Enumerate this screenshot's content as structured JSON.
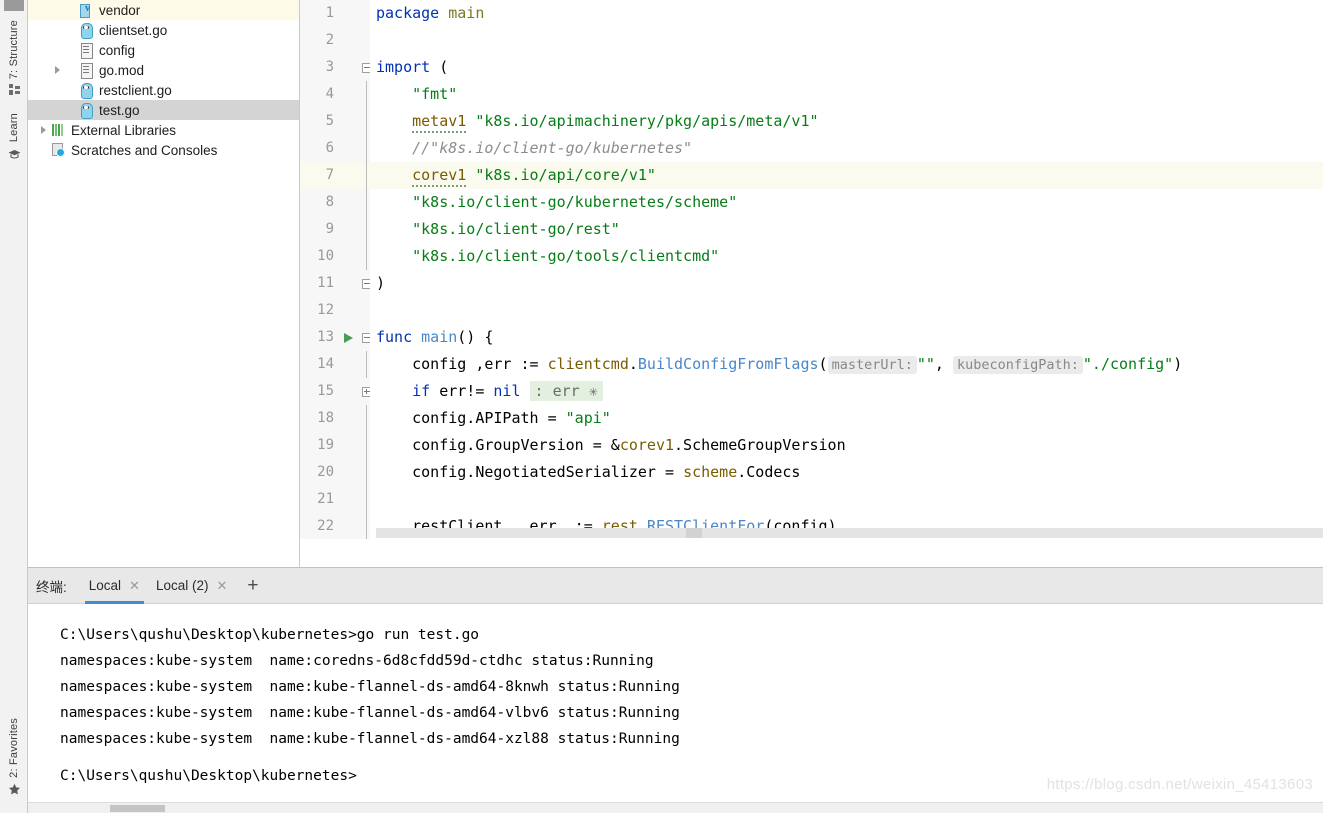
{
  "tool_strip": {
    "top_items": [
      {
        "label": "7: Structure",
        "icon": "structure-icon"
      },
      {
        "label": "Learn",
        "icon": "graduation-cap-icon"
      }
    ],
    "bottom_items": [
      {
        "label": "2: Favorites",
        "icon": "star-icon"
      }
    ]
  },
  "project_tree": {
    "items": [
      {
        "label": "vendor",
        "icon": "vendor-folder-icon",
        "indent": 2,
        "arrow": false,
        "state": "highlighted"
      },
      {
        "label": "clientset.go",
        "icon": "go-file-icon",
        "indent": 2,
        "arrow": false,
        "state": "normal"
      },
      {
        "label": "config",
        "icon": "text-file-icon",
        "indent": 2,
        "arrow": false,
        "state": "normal"
      },
      {
        "label": "go.mod",
        "icon": "text-file-icon",
        "indent": 2,
        "arrow": true,
        "state": "normal"
      },
      {
        "label": "restclient.go",
        "icon": "go-file-icon",
        "indent": 2,
        "arrow": false,
        "state": "normal"
      },
      {
        "label": "test.go",
        "icon": "go-file-icon",
        "indent": 2,
        "arrow": false,
        "state": "selected"
      },
      {
        "label": "External Libraries",
        "icon": "libraries-icon",
        "indent": 1,
        "arrow": true,
        "state": "normal"
      },
      {
        "label": "Scratches and Consoles",
        "icon": "scratches-icon",
        "indent": 1,
        "arrow": false,
        "state": "normal"
      }
    ]
  },
  "editor": {
    "lines": [
      {
        "num": "1",
        "fold": "",
        "highlight": false
      },
      {
        "num": "2",
        "fold": "",
        "highlight": false
      },
      {
        "num": "3",
        "fold": "open",
        "highlight": false
      },
      {
        "num": "4",
        "fold": "",
        "highlight": false
      },
      {
        "num": "5",
        "fold": "",
        "highlight": false
      },
      {
        "num": "6",
        "fold": "",
        "highlight": false
      },
      {
        "num": "7",
        "fold": "",
        "highlight": true
      },
      {
        "num": "8",
        "fold": "",
        "highlight": false
      },
      {
        "num": "9",
        "fold": "",
        "highlight": false
      },
      {
        "num": "10",
        "fold": "",
        "highlight": false
      },
      {
        "num": "11",
        "fold": "end",
        "highlight": false
      },
      {
        "num": "12",
        "fold": "",
        "highlight": false
      },
      {
        "num": "13",
        "fold": "open",
        "highlight": false,
        "run_marker": true
      },
      {
        "num": "14",
        "fold": "",
        "highlight": false
      },
      {
        "num": "15",
        "fold": "closed",
        "highlight": false
      },
      {
        "num": "18",
        "fold": "",
        "highlight": false
      },
      {
        "num": "19",
        "fold": "",
        "highlight": false
      },
      {
        "num": "20",
        "fold": "",
        "highlight": false
      },
      {
        "num": "21",
        "fold": "",
        "highlight": false
      },
      {
        "num": "22",
        "fold": "",
        "highlight": false
      }
    ],
    "code": {
      "l1_package": "package",
      "l1_main": "main",
      "l3_import": "import",
      "l3_paren": "(",
      "l4_fmt": "\"fmt\"",
      "l5_alias": "metav1",
      "l5_path": "\"k8s.io/apimachinery/pkg/apis/meta/v1\"",
      "l6_comment": "//\"k8s.io/client-go/kubernetes\"",
      "l7_alias": "corev1",
      "l7_path": "\"k8s.io/api/core/v1\"",
      "l8_path": "\"k8s.io/client-go/kubernetes/scheme\"",
      "l9_path": "\"k8s.io/client-go/rest\"",
      "l10_path": "\"k8s.io/client-go/tools/clientcmd\"",
      "l11_close": ")",
      "l13_func": "func",
      "l13_name": "main",
      "l13_sig": "() {",
      "l14_lhs": "config ,err := ",
      "l14_pkg": "clientcmd",
      "l14_dot": ".",
      "l14_fn": "BuildConfigFromFlags",
      "l14_open": "(",
      "l14_hint1": "masterUrl:",
      "l14_arg1": "\"\"",
      "l14_comma": ", ",
      "l14_hint2": "kubeconfigPath:",
      "l14_arg2": "\"./config\"",
      "l14_close": ")",
      "l15_if": "if",
      "l15_cond": " err!= ",
      "l15_nil": "nil",
      "l15_folded": ": err ✳",
      "l18_lhs": "config.APIPath = ",
      "l18_rhs": "\"api\"",
      "l19_lhs": "config.GroupVersion = &",
      "l19_pkg": "corev1",
      "l19_rest": ".SchemeGroupVersion",
      "l20_lhs": "config.NegotiatedSerializer = ",
      "l20_pkg": "scheme",
      "l20_rest": ".Codecs",
      "l22_a": "restClient  ,",
      "l22_err": "err",
      "l22_b": "  := ",
      "l22_pkg": "rest",
      "l22_dot": ".",
      "l22_fn": "RESTClientFor",
      "l22_args": "(config)"
    }
  },
  "terminal": {
    "title": "终端:",
    "tabs": [
      {
        "label": "Local",
        "active": true,
        "closable": true
      },
      {
        "label": "Local (2)",
        "active": false,
        "closable": true
      }
    ],
    "add_label": "+",
    "output": [
      {
        "text": "C:\\Users\\qushu\\Desktop\\kubernetes>go run test.go",
        "gap": false
      },
      {
        "text": "namespaces:kube-system  name:coredns-6d8cfdd59d-ctdhc status:Running",
        "gap": false
      },
      {
        "text": "namespaces:kube-system  name:kube-flannel-ds-amd64-8knwh status:Running",
        "gap": false
      },
      {
        "text": "namespaces:kube-system  name:kube-flannel-ds-amd64-vlbv6 status:Running",
        "gap": false
      },
      {
        "text": "namespaces:kube-system  name:kube-flannel-ds-amd64-xzl88 status:Running",
        "gap": false
      },
      {
        "text": "C:\\Users\\qushu\\Desktop\\kubernetes>",
        "gap": true
      }
    ]
  },
  "watermark": "https://blog.csdn.net/weixin_45413603",
  "colors": {
    "keyword": "#0033b3",
    "string": "#067d17",
    "comment": "#8c8c8c",
    "function": "#4a86c8",
    "package": "#7a7a25",
    "accent": "#3f8cce",
    "run_green": "#499c54",
    "highlight_row": "#fbfaee",
    "selection_grey": "#d4d4d4"
  }
}
